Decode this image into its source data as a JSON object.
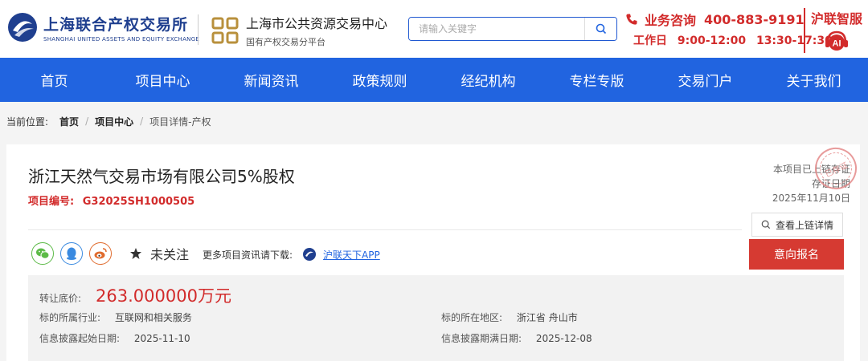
{
  "header": {
    "logo1": {
      "cn": "上海联合产权交易所",
      "en": "SHANGHAI UNITED ASSETS AND EQUITY EXCHANGE"
    },
    "logo2": {
      "cn": "上海市公共资源交易中心",
      "sub": "国有产权交易分平台"
    },
    "search": {
      "placeholder": "请输入关键字"
    },
    "hotline": {
      "label": "业务咨询",
      "number": "400-883-9191"
    },
    "workhours": {
      "label": "工作日",
      "am": "9:00-12:00",
      "pm": "13:30-17:30"
    },
    "assistant": {
      "label": "沪联智服"
    }
  },
  "nav": {
    "items": [
      {
        "label": "首页"
      },
      {
        "label": "项目中心"
      },
      {
        "label": "新闻资讯"
      },
      {
        "label": "政策规则"
      },
      {
        "label": "经纪机构"
      },
      {
        "label": "专栏专版"
      },
      {
        "label": "交易门户"
      },
      {
        "label": "关于我们"
      }
    ]
  },
  "breadcrumb": {
    "label": "当前位置:",
    "items": [
      "首页",
      "项目中心",
      "项目详情-产权"
    ],
    "separator": "/"
  },
  "project": {
    "title": "浙江天然气交易市场有限公司5%股权",
    "number_label": "项目编号:",
    "number": "G32025SH1000505",
    "chain_status": "本项目已上链存证",
    "chain_date_label": "存证日期",
    "chain_date": "2025年11月10日",
    "stamp_text": "已存证",
    "view_chain_label": "查看上链详情",
    "signup_label": "意向报名",
    "follow_label": "未关注",
    "download_label": "更多项目资讯请下载:",
    "app_link": "沪联天下APP"
  },
  "info": {
    "price_label": "转让底价:",
    "price_value": "263.000000万元",
    "industry_label": "标的所属行业:",
    "industry": "互联网和相关服务",
    "region_label": "标的所在地区:",
    "region": "浙江省 舟山市",
    "start_label": "信息披露起始日期:",
    "start_date": "2025-11-10",
    "end_label": "信息披露期满日期:",
    "end_date": "2025-12-08"
  },
  "colors": {
    "brand_blue": "#2164e0",
    "accent_red": "#d22b2b",
    "signup_red": "#d63a32"
  },
  "icons": [
    "logo-mark",
    "search-icon",
    "phone-icon",
    "ai-assistant-icon",
    "wechat-icon",
    "qq-icon",
    "weibo-icon",
    "star-icon",
    "app-logo-icon"
  ]
}
